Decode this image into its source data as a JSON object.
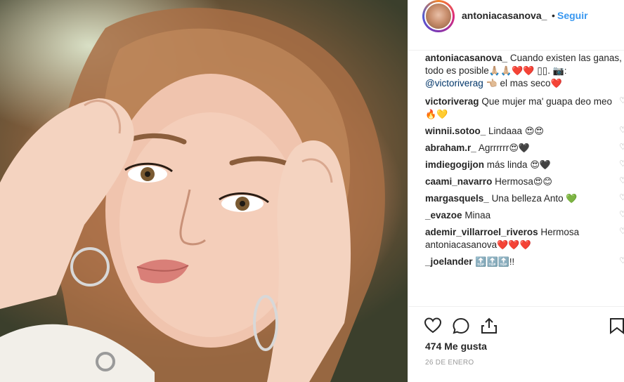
{
  "header": {
    "username": "antoniacasanova_",
    "separator": "•",
    "follow_label": "Seguir"
  },
  "caption": {
    "user": "antoniacasanova_",
    "text1": "Cuando existen las ganas, todo es posible",
    "emojis1": "🙏🏼🙏🏼❤️❤️",
    "boxes": "▯▯.",
    "camera": "📷:",
    "mention": "@victoriverag",
    "emoji2": "👈🏼",
    "text2": "el mas seco",
    "emoji3": "❤️"
  },
  "comments": [
    {
      "user": "victoriverag",
      "text": "Que mujer ma' guapa deo meo",
      "emojis": "🔥💛"
    },
    {
      "user": "winnii.sotoo_",
      "text": "Lindaaa",
      "emojis": "😍😍"
    },
    {
      "user": "abraham.r_",
      "text": "Agrrrrrr",
      "emojis": "😍🖤"
    },
    {
      "user": "imdiegogijon",
      "text": "más linda",
      "emojis": "😍🖤"
    },
    {
      "user": "caami_navarro",
      "text": "Hermosa",
      "emojis": "😍😊"
    },
    {
      "user": "margasquels_",
      "text": "Una belleza Anto",
      "emojis": "💚"
    },
    {
      "user": "_evazoe",
      "text": "Minaa",
      "emojis": ""
    },
    {
      "user": "ademir_villarroel_riveros",
      "text": "Hermosa antoniacasanova",
      "emojis": "❤️❤️❤️"
    },
    {
      "user": "_joelander",
      "text": "",
      "emojis": "🔝🔝🔝!!"
    }
  ],
  "actions": {
    "like_icon": "heart-outline-icon",
    "comment_icon": "speech-bubble-icon",
    "share_icon": "share-icon",
    "save_icon": "bookmark-icon"
  },
  "likes": "474 Me gusta",
  "date": "26 DE ENERO",
  "colors": {
    "link_blue": "#3897f0",
    "mention_blue": "#003569",
    "text": "#262626",
    "muted": "#999999",
    "border": "#efefef"
  }
}
